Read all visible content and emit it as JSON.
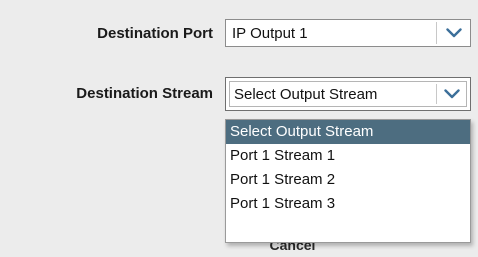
{
  "form": {
    "port": {
      "label": "Destination Port",
      "value": "IP Output 1"
    },
    "stream": {
      "label": "Destination Stream",
      "value": "Select Output Stream",
      "options": [
        "Select Output Stream",
        "Port 1 Stream 1",
        "Port 1 Stream 2",
        "Port 1 Stream 3"
      ],
      "selected_index": 0
    },
    "cancel_label": "Cancel"
  },
  "icons": {
    "dropdown_arrow": "chevron-down-icon"
  },
  "colors": {
    "background": "#ececec",
    "highlight": "#4d6d80",
    "chevron": "#3c6f9a"
  }
}
